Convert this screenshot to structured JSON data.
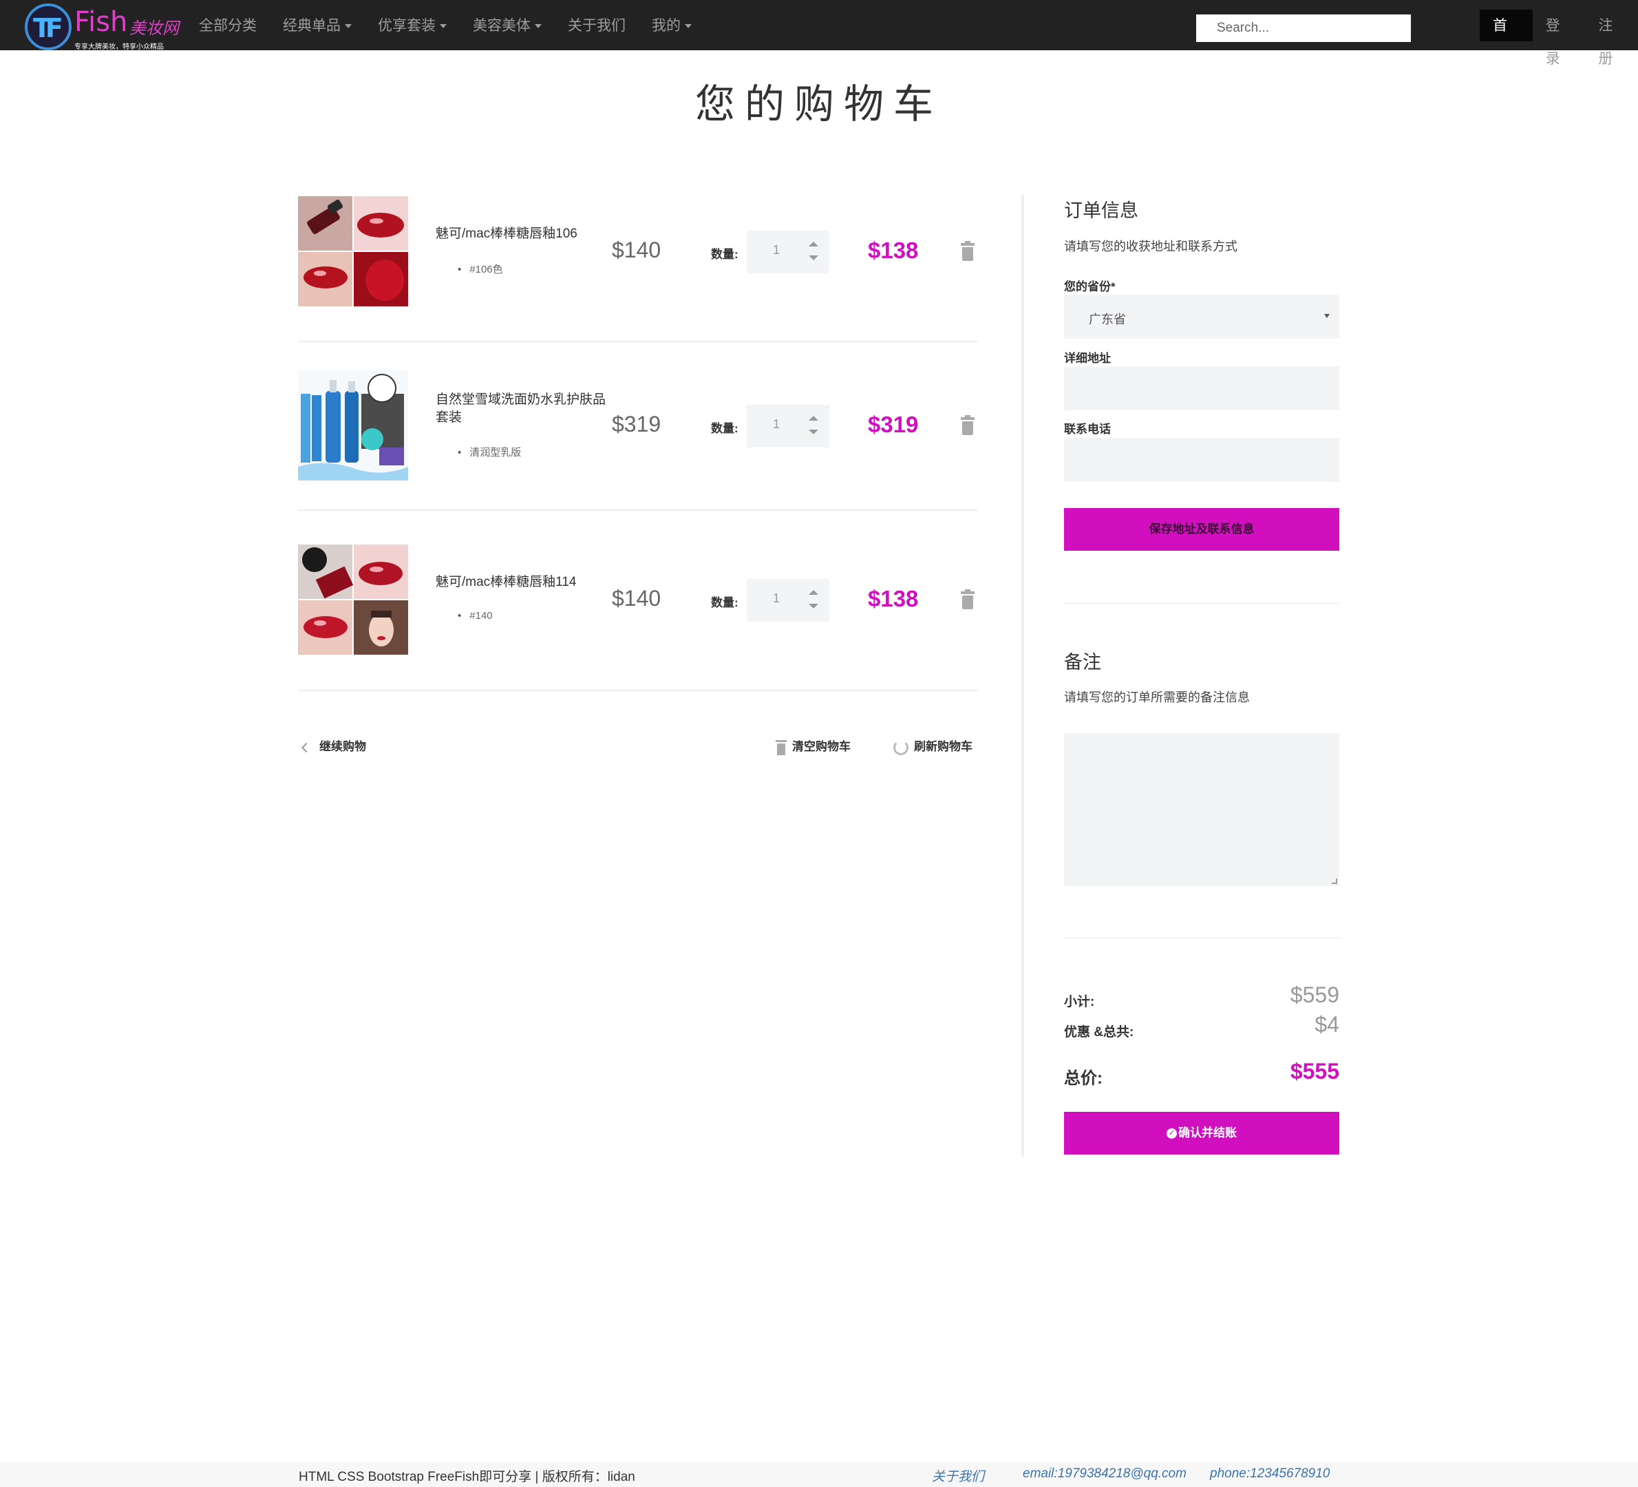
{
  "nav": {
    "logo_text": "Fish",
    "logo_cn": "美妆网",
    "logo_slogan": "专享大牌美妆，特享小众精品",
    "menu": [
      {
        "label": "全部分类",
        "caret": false
      },
      {
        "label": "经典单品",
        "caret": true
      },
      {
        "label": "优享套装",
        "caret": true
      },
      {
        "label": "美容美体",
        "caret": true
      },
      {
        "label": "关于我们",
        "caret": false
      },
      {
        "label": "我的",
        "caret": true
      }
    ],
    "search_placeholder": "Search...",
    "right": [
      "首页",
      "登录",
      "注册"
    ]
  },
  "page_title": "您的购物车",
  "cart": {
    "items": [
      {
        "name": "魅可/mac棒棒糖唇釉106",
        "variant": "#106色",
        "price": "$140",
        "qty_label": "数量:",
        "qty": "1",
        "total": "$138"
      },
      {
        "name": "自然堂雪域洗面奶水乳护肤品套装",
        "variant": "清润型乳版",
        "price": "$319",
        "qty_label": "数量:",
        "qty": "1",
        "total": "$319"
      },
      {
        "name": "魅可/mac棒棒糖唇釉114",
        "variant": "#140",
        "price": "$140",
        "qty_label": "数量:",
        "qty": "1",
        "total": "$138"
      }
    ],
    "continue_label": "继续购物",
    "clear_label": "清空购物车",
    "refresh_label": "刷新购物车"
  },
  "order": {
    "heading": "订单信息",
    "desc": "请填写您的收获地址和联系方式",
    "province_label": "您的省份*",
    "province_value": "广东省",
    "address_label": "详细地址",
    "phone_label": "联系电话",
    "save_button": "保存地址及联系信息"
  },
  "notes": {
    "heading": "备注",
    "desc": "请填写您的订单所需要的备注信息"
  },
  "summary": {
    "subtotal_label": "小计:",
    "subtotal": "$559",
    "discount_label": "优惠 &总共:",
    "discount": "$4",
    "total_label": "总价:",
    "total": "$555",
    "checkout_button": "确认并结账"
  },
  "footer": {
    "copyright": "HTML CSS Bootstrap FreeFish即可分享 | 版权所有：lidan",
    "about": "关于我们",
    "email": "email:1979384218@qq.com",
    "phone": "phone:12345678910"
  },
  "colors": {
    "accent": "#d10fbe",
    "navbar": "#222222",
    "link": "#3b73b0"
  }
}
